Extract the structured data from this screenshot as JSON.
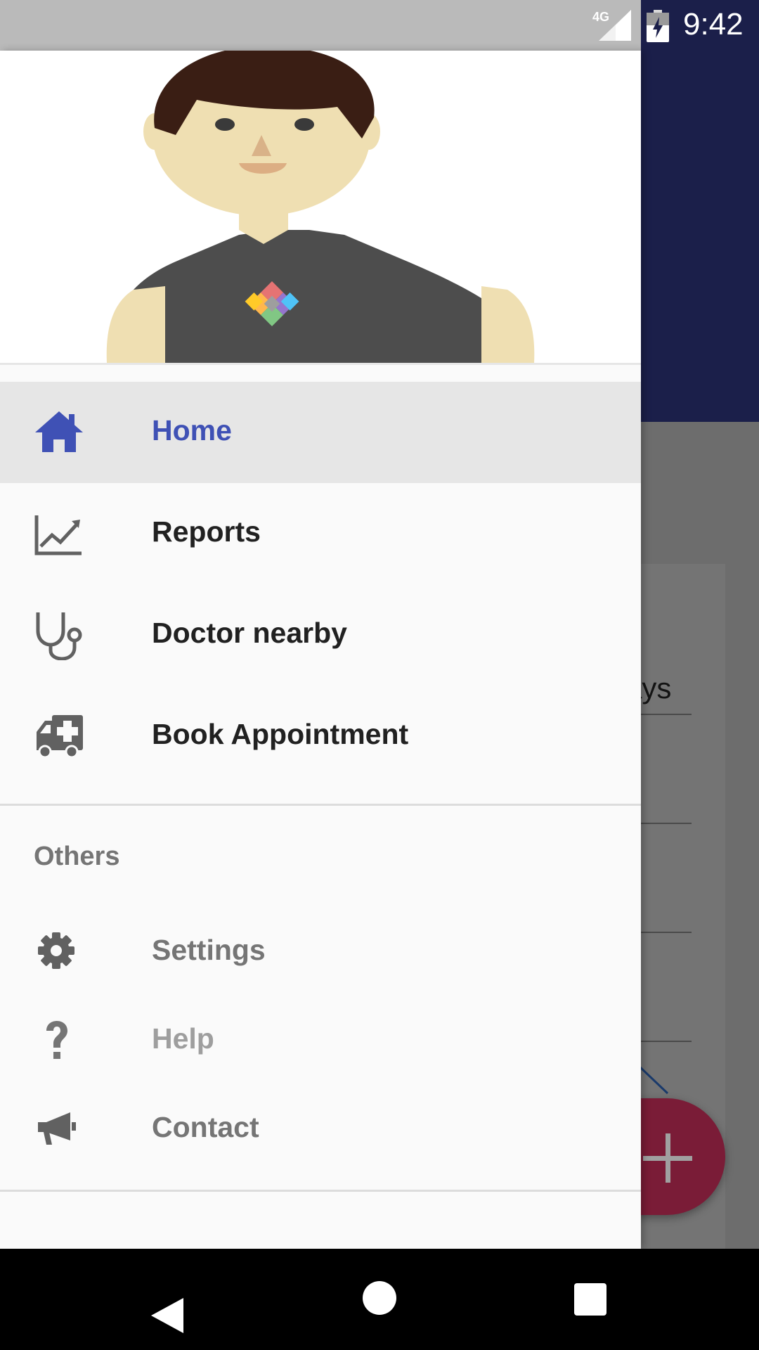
{
  "status_bar": {
    "time": "9:42",
    "network_type": "4G"
  },
  "background": {
    "field_text": "ays"
  },
  "drawer": {
    "main_items": [
      {
        "label": "Home",
        "icon": "home-icon",
        "active": true
      },
      {
        "label": "Reports",
        "icon": "chart-line-icon",
        "active": false
      },
      {
        "label": "Doctor nearby",
        "icon": "stethoscope-icon",
        "active": false
      },
      {
        "label": "Book Appointment",
        "icon": "ambulance-icon",
        "active": false
      }
    ],
    "section_title": "Others",
    "other_items": [
      {
        "label": "Settings",
        "icon": "gear-icon"
      },
      {
        "label": "Help",
        "icon": "question-icon"
      },
      {
        "label": "Contact",
        "icon": "megaphone-icon"
      }
    ]
  },
  "colors": {
    "accent": "#3f51b5",
    "toolbar": "#1b1f4a",
    "fab": "#7a1c37",
    "active_item_bg": "#e6e6e6"
  }
}
